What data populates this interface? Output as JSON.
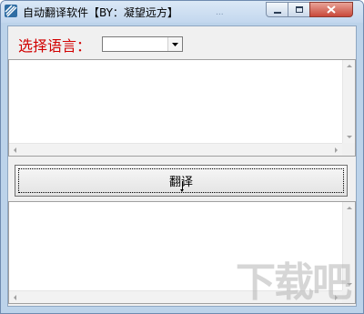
{
  "window": {
    "title": "自动翻译软件【BY：凝望远方】",
    "faint_text": "...",
    "accent_color": "#bcd3ea",
    "close_color": "#c9483a"
  },
  "controls": {
    "minimize_icon": "minimize-icon",
    "maximize_icon": "maximize-icon",
    "close_icon": "close-icon"
  },
  "language": {
    "label": "选择语言：",
    "label_color": "#d10000",
    "selected_value": ""
  },
  "input_text": "",
  "translate_button": {
    "label": "翻译"
  },
  "output_text": "",
  "watermark": "下载吧"
}
